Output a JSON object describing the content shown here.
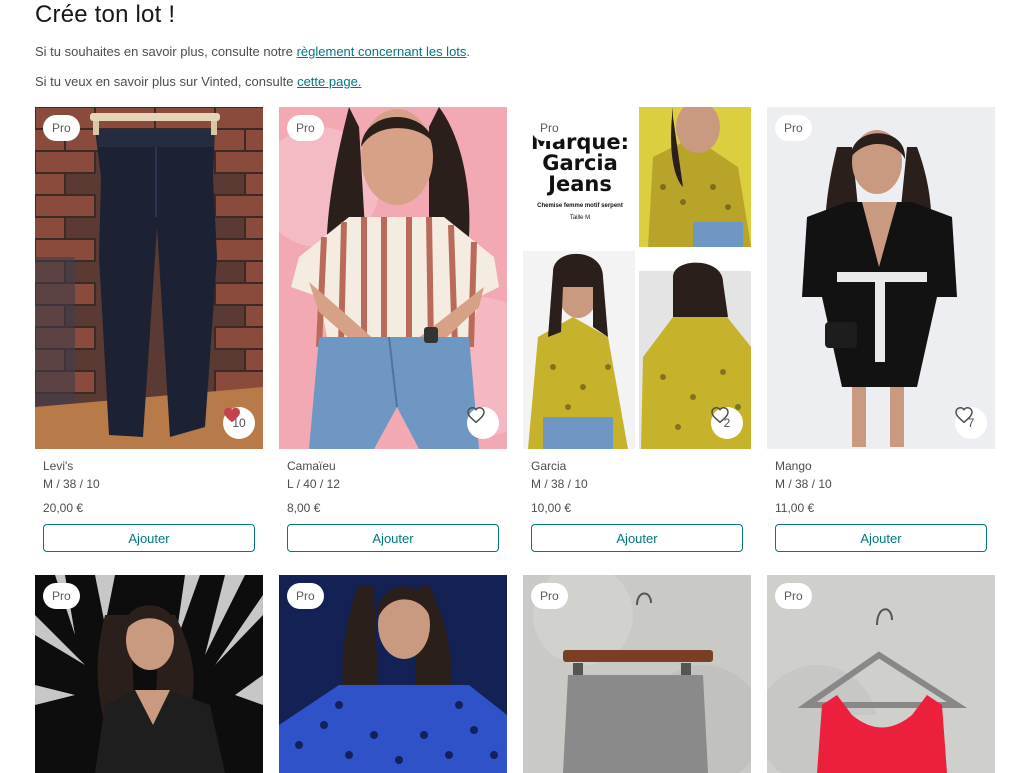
{
  "header": {
    "title": "Crée ton lot !",
    "info1_prefix": "Si tu souhaites en savoir plus, consulte notre ",
    "info1_link": "règlement concernant les lots",
    "info1_suffix": ".",
    "info2_prefix": "Si tu veux en savoir plus sur Vinted, consulte ",
    "info2_link": "cette page."
  },
  "poster": {
    "brand": "Marque: Garcia Jeans",
    "subtitle": "Chemise femme motif serpent",
    "size": "Taille M"
  },
  "colors": {
    "accent": "#007782",
    "liked": "#c7424f"
  },
  "items": [
    {
      "badge": "Pro",
      "brand": "Levi's",
      "size": "M / 38 / 10",
      "price": "20,00 €",
      "likes": "10",
      "liked": true,
      "button": "Ajouter"
    },
    {
      "badge": "Pro",
      "brand": "Camaïeu",
      "size": "L / 40 / 12",
      "price": "8,00 €",
      "likes": "",
      "liked": false,
      "button": "Ajouter"
    },
    {
      "badge": "Pro",
      "brand": "Garcia",
      "size": "M / 38 / 10",
      "price": "10,00 €",
      "likes": "2",
      "liked": false,
      "button": "Ajouter"
    },
    {
      "badge": "Pro",
      "brand": "Mango",
      "size": "M / 38 / 10",
      "price": "11,00 €",
      "likes": "7",
      "liked": false,
      "button": "Ajouter"
    },
    {
      "badge": "Pro"
    },
    {
      "badge": "Pro"
    },
    {
      "badge": "Pro"
    },
    {
      "badge": "Pro"
    }
  ]
}
